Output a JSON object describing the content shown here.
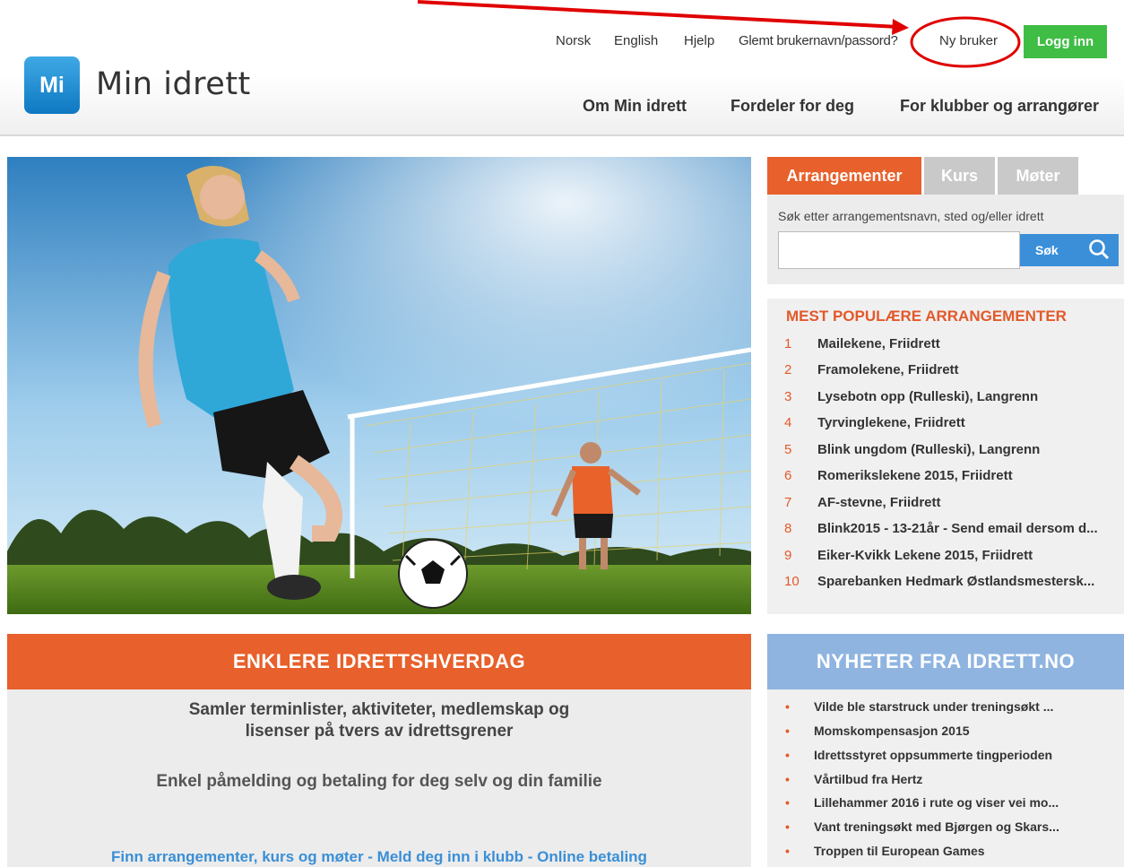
{
  "header": {
    "logo_badge": "Mi",
    "logo_text": "Min idrett",
    "util_links": {
      "norsk": "Norsk",
      "english": "English",
      "help": "Hjelp",
      "forgot": "Glemt brukernavn/passord?",
      "new_user": "Ny bruker"
    },
    "login_label": "Logg inn",
    "main_nav": {
      "about": "Om Min idrett",
      "benefits": "Fordeler for deg",
      "clubs": "For klubber og arrangører"
    }
  },
  "search": {
    "tabs": [
      "Arrangementer",
      "Kurs",
      "Møter"
    ],
    "hint": "Søk etter arrangementsnavn, sted og/eller idrett",
    "input_value": "",
    "button_label": "Søk"
  },
  "popular": {
    "title": "MEST POPULÆRE ARRANGEMENTER",
    "items": [
      {
        "num": "1",
        "text": "Mailekene, Friidrett"
      },
      {
        "num": "2",
        "text": "Framolekene, Friidrett"
      },
      {
        "num": "3",
        "text": "Lysebotn opp (Rulleski), Langrenn"
      },
      {
        "num": "4",
        "text": "Tyrvinglekene, Friidrett"
      },
      {
        "num": "5",
        "text": "Blink ungdom (Rulleski), Langrenn"
      },
      {
        "num": "6",
        "text": "Romerikslekene 2015, Friidrett"
      },
      {
        "num": "7",
        "text": "AF-stevne, Friidrett"
      },
      {
        "num": "8",
        "text": "Blink2015 - 13-21år - Send email dersom d..."
      },
      {
        "num": "9",
        "text": "Eiker-Kvikk Lekene 2015, Friidrett"
      },
      {
        "num": "10",
        "text": "Sparebanken Hedmark Østlandsmestersk..."
      }
    ]
  },
  "feature": {
    "title": "ENKLERE IDRETTSHVERDAG",
    "line1": "Samler terminlister, aktiviteter, medlemskap og",
    "line2": "lisenser på tvers av idrettsgrener",
    "line3": "Enkel påmelding og betaling for deg selv og din familie",
    "link": "Finn arrangementer, kurs og møter - Meld deg inn i klubb - Online betaling"
  },
  "news": {
    "title": "NYHETER FRA IDRETT.NO",
    "items": [
      "Vilde ble starstruck under treningsøkt ...",
      "Momskompensasjon 2015",
      "Idrettsstyret oppsummerte tingperioden",
      "Vårtilbud fra Hertz",
      "Lillehammer 2016 i rute og viser vei mo...",
      "Vant treningsøkt med Bjørgen og Skars...",
      "Troppen til European Games"
    ]
  },
  "colors": {
    "brand_orange": "#e8602b",
    "brand_blue": "#3b8fd9",
    "login_green": "#3fbd45",
    "annotation_red": "#e00000"
  }
}
